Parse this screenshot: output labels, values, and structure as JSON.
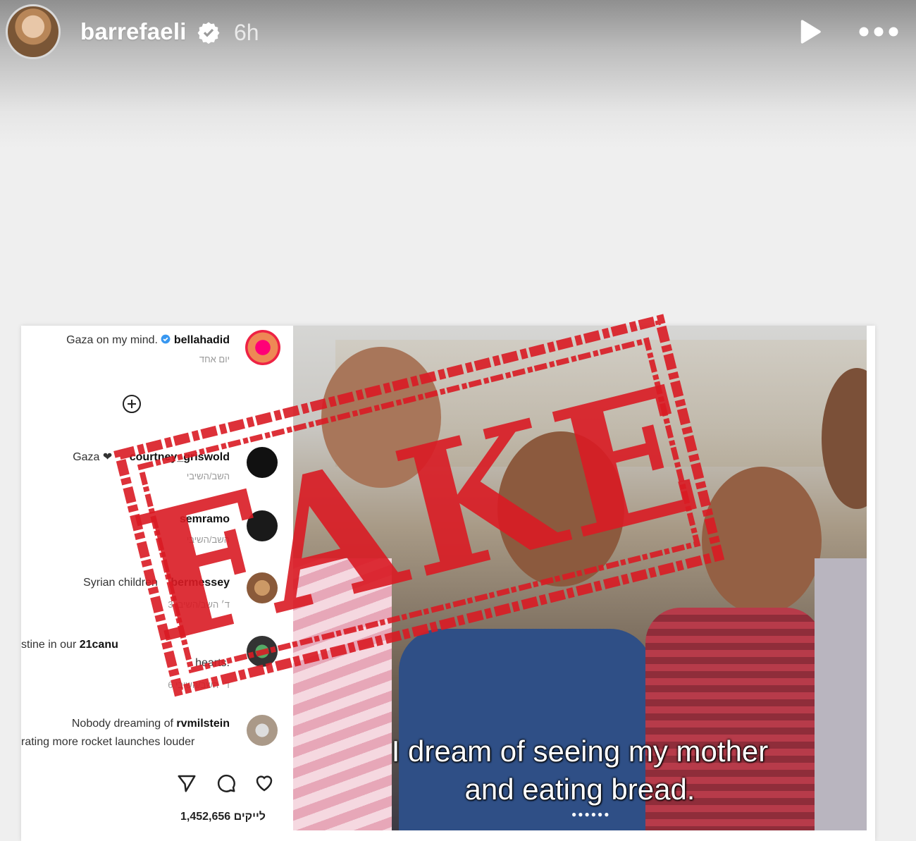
{
  "story": {
    "username": "barrefaeli",
    "time_ago": "6h",
    "icons": {
      "avatar": "profile-avatar",
      "verified": "verified-badge-icon",
      "play": "play-icon",
      "more": "more-icon"
    }
  },
  "post": {
    "comments": [
      {
        "user": "bellahadid",
        "text": "Gaza on my mind.",
        "meta": "יום אחד"
      },
      {
        "user": "courtney_griswold",
        "text": "Gaza ❤",
        "meta": "השב/השיבי"
      },
      {
        "user": "semramo",
        "text": "",
        "meta": "השב/השיבי"
      },
      {
        "user": "bermessey",
        "text": "Syrian children",
        "meta": "3 ד׳ השב/השיבי"
      },
      {
        "user": "21canu",
        "text": "stine in our",
        "extra": "hearts.",
        "meta": "6 ד׳ השב/השיבי"
      },
      {
        "user": "rvmilstein",
        "text": "Nobody dreaming of",
        "extra": "rating more rocket launches louder",
        "meta": ""
      }
    ],
    "likes": "1,452,656 לייקים",
    "caption_line1": "I dream of seeing my mother",
    "caption_line2": "and eating bread.",
    "stamp_text": "FAKE",
    "stamp_color": "#d91b24"
  }
}
